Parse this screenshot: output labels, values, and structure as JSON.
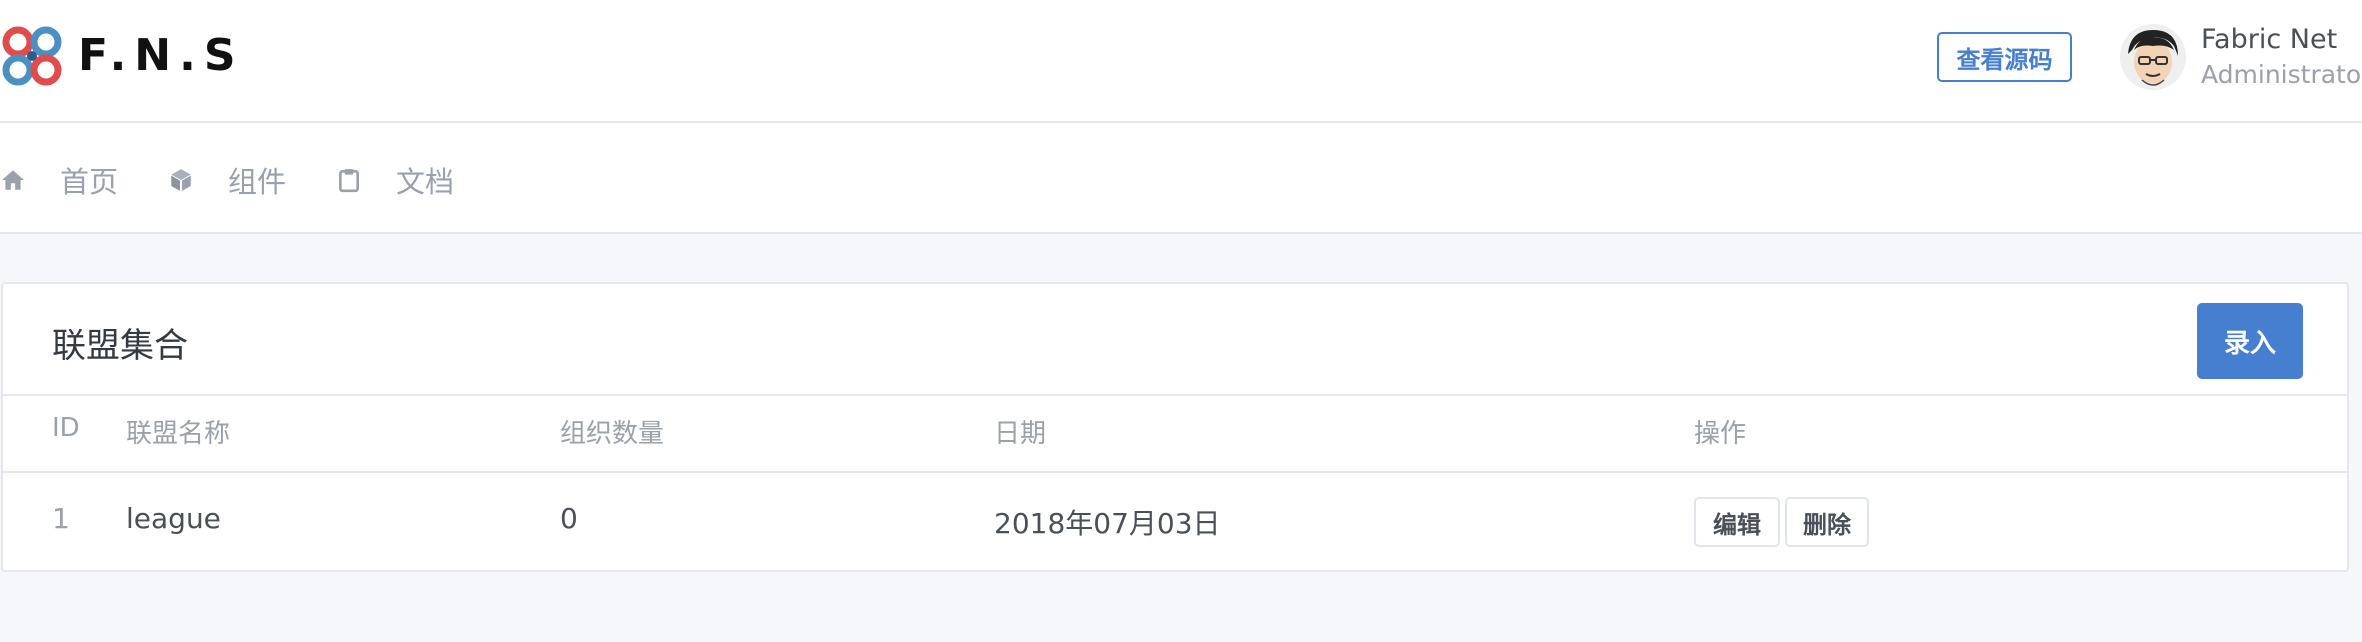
{
  "header": {
    "brand": "F.N.S",
    "source_button": "查看源码",
    "user_name": "Fabric Net",
    "user_role": "Administrator"
  },
  "nav": {
    "items": [
      {
        "label": "首页",
        "icon": "home-icon"
      },
      {
        "label": "组件",
        "icon": "box-icon"
      },
      {
        "label": "文档",
        "icon": "clipboard-icon"
      }
    ]
  },
  "card": {
    "title": "联盟集合",
    "add_button": "录入",
    "columns": [
      "ID",
      "联盟名称",
      "组织数量",
      "日期",
      "操作"
    ],
    "rows": [
      {
        "id": "1",
        "name": "league",
        "org_count": "0",
        "date": "2018年07月03日",
        "edit": "编辑",
        "delete": "删除"
      }
    ]
  },
  "colors": {
    "accent": "#467fcf",
    "muted_text": "#9aa0ac",
    "background": "#f5f7fb"
  }
}
